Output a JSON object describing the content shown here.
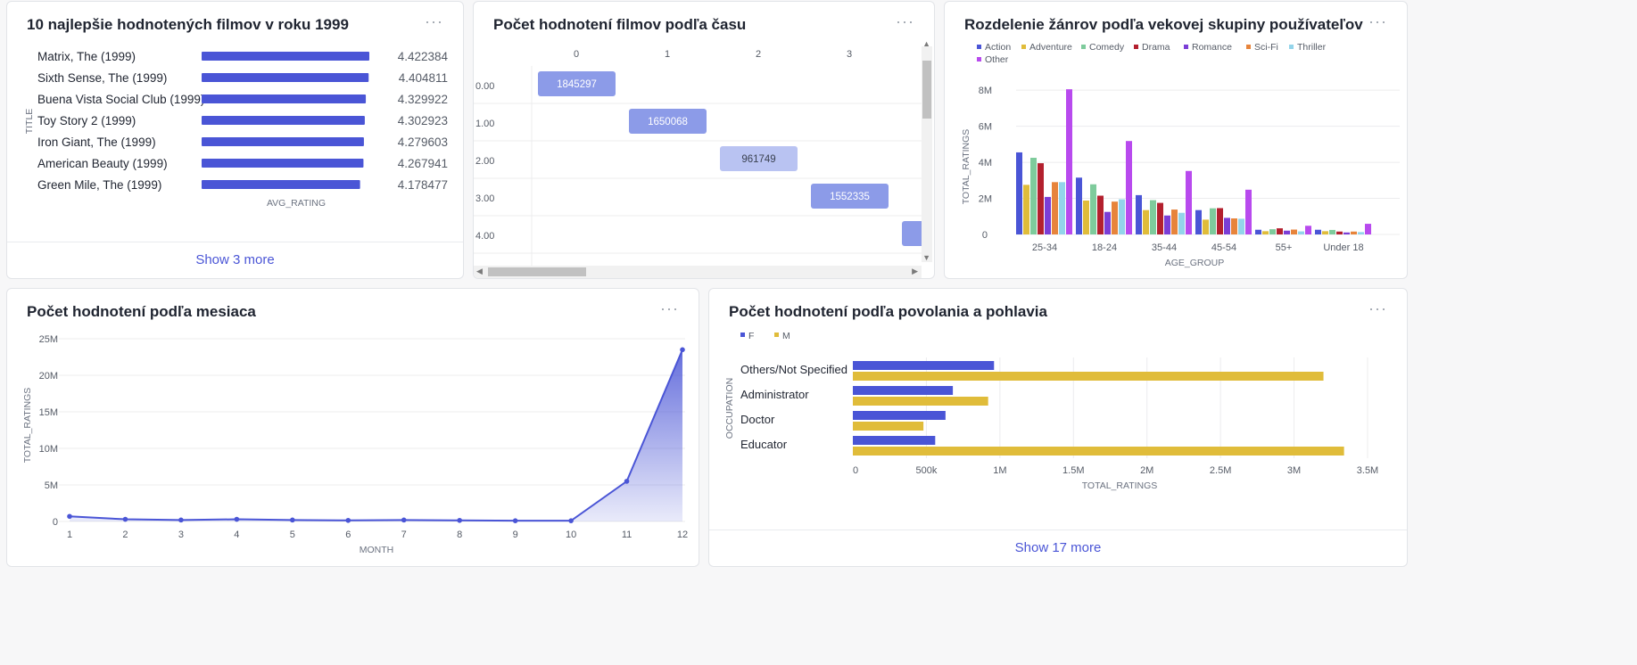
{
  "colors": {
    "primary": "#4a55d6",
    "heat_strong": "#8c9be8",
    "heat_light": "#b9c3f2",
    "genres": {
      "Action": "#4a55d6",
      "Adventure": "#e0bc3a",
      "Comedy": "#7ecb9c",
      "Drama": "#b3202e",
      "Romance": "#7b3ed6",
      "Sci-Fi": "#e7843b",
      "Thriller": "#93d4ea",
      "Other": "#b84aee"
    },
    "gender": {
      "F": "#4a55d6",
      "M": "#e0bc3a"
    }
  },
  "card1": {
    "title": "10 najlepšie hodnotených filmov v roku 1999",
    "footer": "Show 3 more",
    "chart_data": {
      "type": "bar",
      "orientation": "horizontal",
      "ylabel": "TITLE",
      "xlabel": "AVG_RATING",
      "categories": [
        "Matrix, The (1999)",
        "Sixth Sense, The (1999)",
        "Buena Vista Social Club (1999)",
        "Toy Story 2 (1999)",
        "Iron Giant, The (1999)",
        "American Beauty (1999)",
        "Green Mile, The (1999)"
      ],
      "values": [
        4.422384,
        4.404811,
        4.329922,
        4.302923,
        4.279603,
        4.267941,
        4.178477
      ],
      "value_labels": [
        "4.422384",
        "4.404811",
        "4.329922",
        "4.302923",
        "4.279603",
        "4.267941",
        "4.178477"
      ]
    }
  },
  "card2": {
    "title": "Počet hodnotení filmov podľa času",
    "chart_data": {
      "type": "heatmap",
      "columns": [
        "0",
        "1",
        "2",
        "3"
      ],
      "rows": [
        "0.00",
        "1.00",
        "2.00",
        "3.00",
        "4.00"
      ],
      "cells": [
        {
          "row": "0.00",
          "col": "0",
          "value": 1845297,
          "label": "1845297"
        },
        {
          "row": "1.00",
          "col": "1",
          "value": 1650068,
          "label": "1650068"
        },
        {
          "row": "2.00",
          "col": "2",
          "value": 961749,
          "label": "961749"
        },
        {
          "row": "3.00",
          "col": "3",
          "value": 1552335,
          "label": "1552335"
        },
        {
          "row": "4.00",
          "col": "4",
          "value": null,
          "label": ""
        }
      ]
    }
  },
  "card3": {
    "title": "Rozdelenie žánrov podľa vekovej skupiny používateľov",
    "chart_data": {
      "type": "bar",
      "xlabel": "AGE_GROUP",
      "ylabel": "TOTAL_RATINGS",
      "legend_position": "top-left",
      "categories": [
        "25-34",
        "18-24",
        "35-44",
        "45-54",
        "55+",
        "Under 18"
      ],
      "ylim": [
        0,
        8600000
      ],
      "y_ticks": [
        "0",
        "2M",
        "4M",
        "6M",
        "8M"
      ],
      "series": [
        {
          "name": "Action",
          "values": [
            4550000,
            3150000,
            2180000,
            1350000,
            260000,
            260000
          ]
        },
        {
          "name": "Adventure",
          "values": [
            2750000,
            1880000,
            1350000,
            820000,
            180000,
            180000
          ]
        },
        {
          "name": "Comedy",
          "values": [
            4250000,
            2780000,
            1900000,
            1450000,
            290000,
            250000
          ]
        },
        {
          "name": "Drama",
          "values": [
            3950000,
            2150000,
            1750000,
            1460000,
            340000,
            160000
          ]
        },
        {
          "name": "Romance",
          "values": [
            2080000,
            1250000,
            1050000,
            920000,
            210000,
            110000
          ]
        },
        {
          "name": "Sci-Fi",
          "values": [
            2900000,
            1820000,
            1380000,
            890000,
            270000,
            160000
          ]
        },
        {
          "name": "Thriller",
          "values": [
            2900000,
            1950000,
            1200000,
            870000,
            170000,
            130000
          ]
        },
        {
          "name": "Other",
          "values": [
            8050000,
            5180000,
            3520000,
            2480000,
            480000,
            590000
          ]
        }
      ]
    }
  },
  "card4": {
    "title": "Počet hodnotení podľa mesiaca",
    "chart_data": {
      "type": "area",
      "xlabel": "MONTH",
      "ylabel": "TOTAL_RATINGS",
      "x": [
        1,
        2,
        3,
        4,
        5,
        6,
        7,
        8,
        9,
        10,
        11,
        12
      ],
      "values": [
        700000,
        300000,
        200000,
        300000,
        200000,
        150000,
        200000,
        150000,
        100000,
        100000,
        5500000,
        23500000
      ],
      "ylim": [
        0,
        25000000
      ],
      "y_ticks": [
        "0",
        "5M",
        "10M",
        "15M",
        "20M",
        "25M"
      ],
      "x_ticks": [
        "1",
        "2",
        "3",
        "4",
        "5",
        "6",
        "7",
        "8",
        "9",
        "10",
        "11",
        "12"
      ]
    }
  },
  "card5": {
    "title": "Počet hodnotení podľa povolania a pohlavia",
    "footer": "Show 17 more",
    "chart_data": {
      "type": "bar",
      "orientation": "horizontal",
      "xlabel": "TOTAL_RATINGS",
      "ylabel": "OCCUPATION",
      "legend_position": "top-left",
      "categories": [
        "Others/Not Specified",
        "Administrator",
        "Doctor",
        "Educator"
      ],
      "xlim": [
        0,
        3500000
      ],
      "x_ticks": [
        "0",
        "500k",
        "1M",
        "1.5M",
        "2M",
        "2.5M",
        "3M",
        "3.5M"
      ],
      "series": [
        {
          "name": "F",
          "values": [
            960000,
            680000,
            630000,
            560000
          ]
        },
        {
          "name": "M",
          "values": [
            3200000,
            920000,
            480000,
            3340000
          ]
        }
      ]
    }
  }
}
